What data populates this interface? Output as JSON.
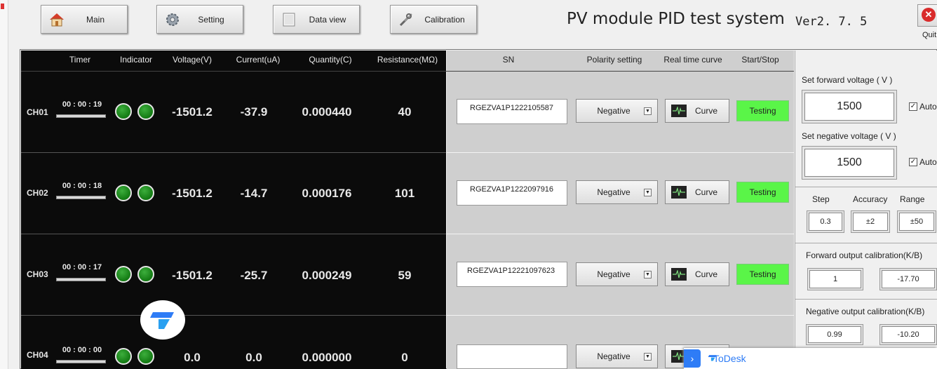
{
  "toolbar": {
    "main_label": "Main",
    "setting_label": "Setting",
    "dataview_label": "Data view",
    "calibration_label": "Calibration"
  },
  "app": {
    "title": "PV module PID test system",
    "version": "Ver2. 7. 5",
    "quit_label": "Quit"
  },
  "columns": {
    "timer": "Timer",
    "indicator": "Indicator",
    "voltage": "Voltage(V)",
    "current": "Current(uA)",
    "quantity": "Quantity(C)",
    "resistance": "Resistance(MΩ)",
    "sn": "SN",
    "polarity": "Polarity setting",
    "curve": "Real time curve",
    "startstop": "Start/Stop"
  },
  "channels": [
    {
      "ch": "CH01",
      "timer": "00 : 00 : 19",
      "voltage": "-1501.2",
      "current": "-37.9",
      "quantity": "0.000440",
      "resistance": "40",
      "sn": "RGEZVA1P1222105587",
      "polarity": "Negative",
      "curve": "Curve",
      "status": "Testing"
    },
    {
      "ch": "CH02",
      "timer": "00 : 00 : 18",
      "voltage": "-1501.2",
      "current": "-14.7",
      "quantity": "0.000176",
      "resistance": "101",
      "sn": "RGEZVA1P1222097916",
      "polarity": "Negative",
      "curve": "Curve",
      "status": "Testing"
    },
    {
      "ch": "CH03",
      "timer": "00 : 00 : 17",
      "voltage": "-1501.2",
      "current": "-25.7",
      "quantity": "0.000249",
      "resistance": "59",
      "sn": "RGEZVA1P12221097623",
      "polarity": "Negative",
      "curve": "Curve",
      "status": "Testing"
    },
    {
      "ch": "CH04",
      "timer": "00 : 00 : 00",
      "voltage": "0.0",
      "current": "0.0",
      "quantity": "0.000000",
      "resistance": "0",
      "sn": "",
      "polarity": "Negative",
      "curve": "",
      "status": ""
    }
  ],
  "panel": {
    "fwd_voltage_label": "Set forward voltage ( V )",
    "fwd_voltage": "1500",
    "fwd_auto": "Auto",
    "neg_voltage_label": "Set negative voltage ( V )",
    "neg_voltage": "1500",
    "neg_auto": "Auto",
    "step_label": "Step",
    "accuracy_label": "Accuracy",
    "range_label": "Range",
    "step": "0.3",
    "accuracy": "±2",
    "range": "±50",
    "fwd_cal_label": "Forward output calibration(K/B)",
    "fwd_k": "1",
    "fwd_b": "-17.70",
    "neg_cal_label": "Negative output calibration(K/B)",
    "neg_k": "0.99",
    "neg_b": "-10.20"
  },
  "overlay": {
    "todesk_label": "ToDesk"
  }
}
